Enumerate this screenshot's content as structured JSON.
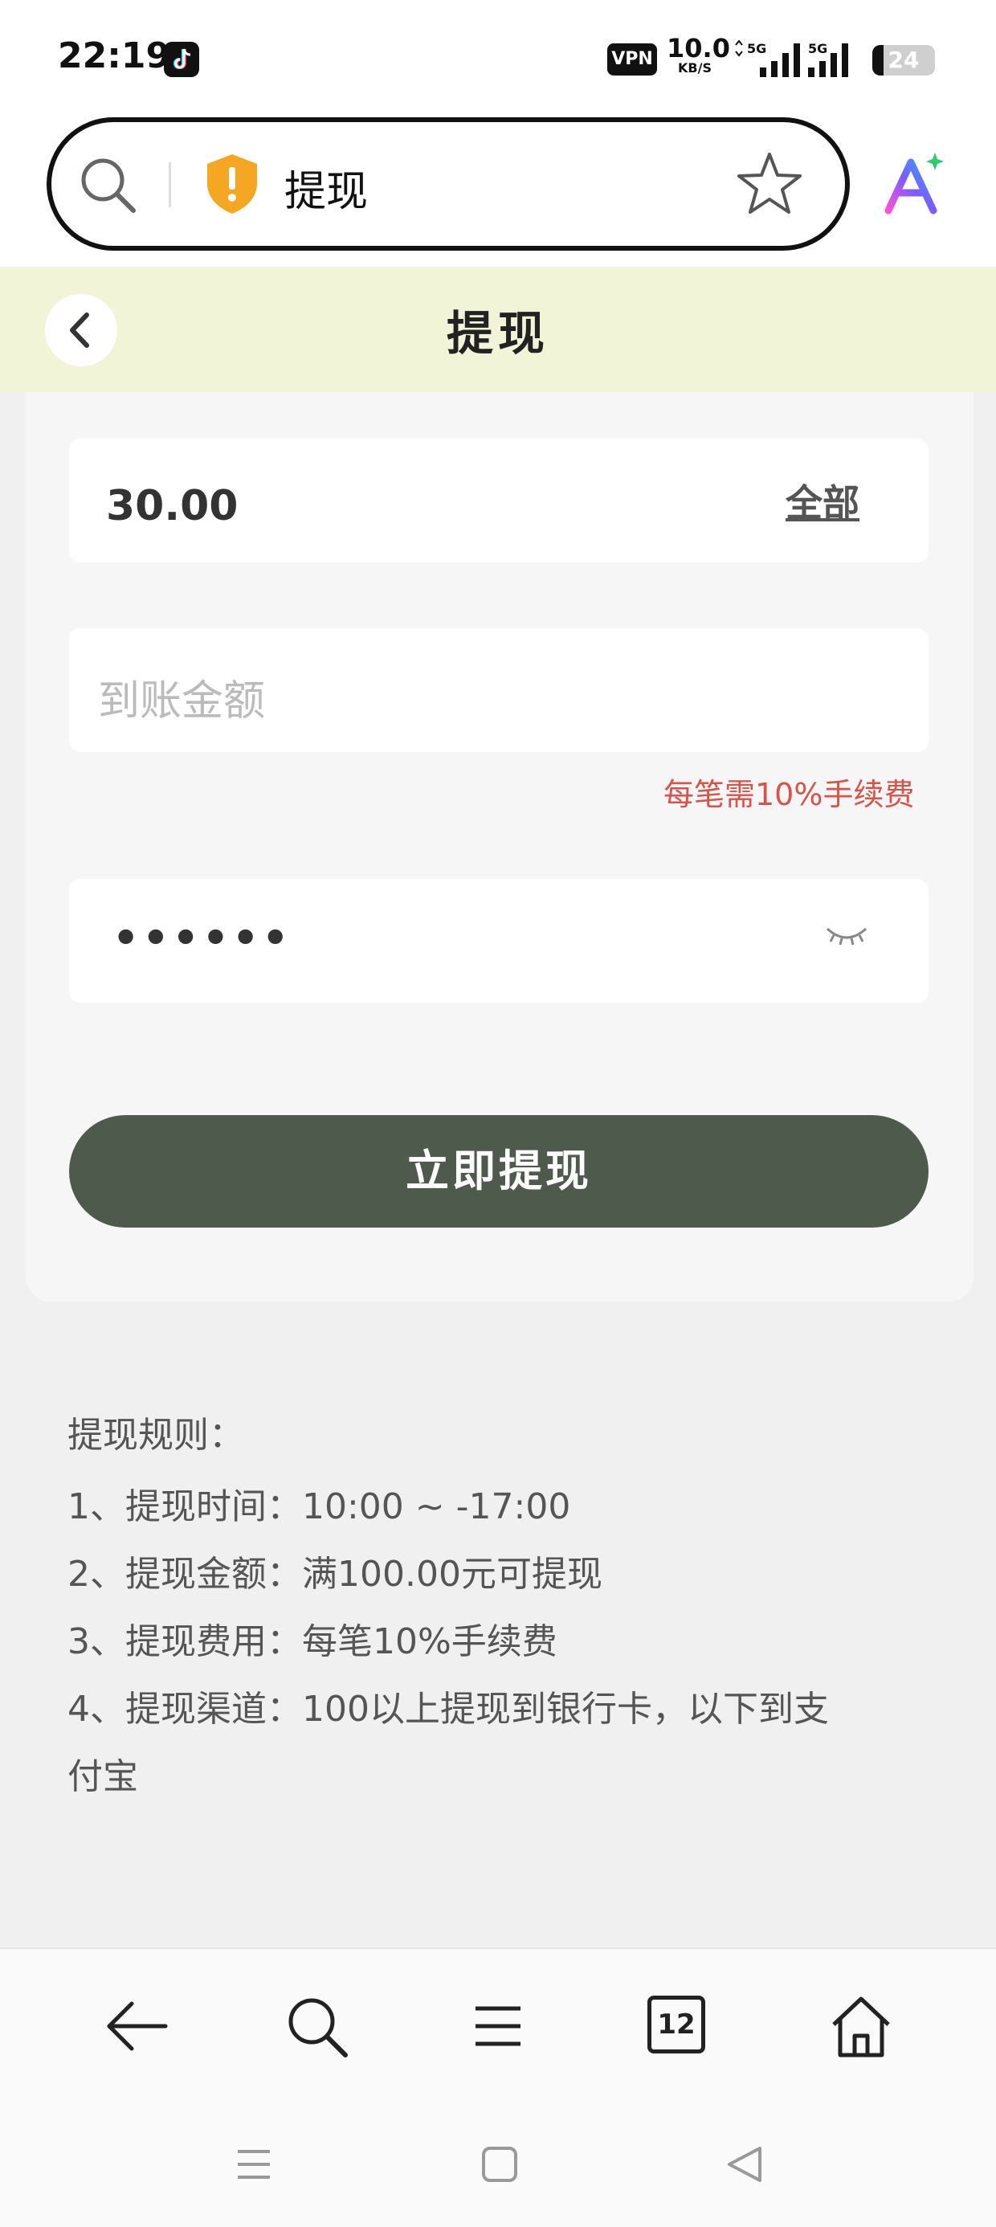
{
  "status_bar": {
    "time": "22:19",
    "vpn": "VPN",
    "net_speed_value": "10.0",
    "net_speed_unit": "KB/S",
    "signal_1_label": "5G",
    "signal_2_label": "5G",
    "battery": "24",
    "icons": [
      "tiktok-icon",
      "signal-icon",
      "battery-icon"
    ]
  },
  "browser": {
    "url_title": "提现",
    "icons": [
      "search-icon",
      "shield-warning-icon",
      "star-icon",
      "ai-assistant-icon"
    ]
  },
  "header": {
    "title": "提现"
  },
  "form": {
    "amount_value": "30.00",
    "all_label": "全部",
    "received_placeholder": "到账金额",
    "fee_note": "每笔需10%手续费",
    "password_mask": "••••••",
    "submit_label": "立即提现"
  },
  "rules": {
    "title": "提现规则：",
    "items": [
      "1、提现时间：10:00 ~ -17:00",
      "2、提现金额：满100.00元可提现",
      "3、提现费用：每笔10%手续费",
      "4、提现渠道：100以上提现到银行卡，以下到支",
      "付宝"
    ]
  },
  "bottom_nav": {
    "tab_count": "12",
    "icons": [
      "back-arrow-icon",
      "search-icon",
      "menu-icon",
      "tabs-icon",
      "home-icon"
    ]
  },
  "system_nav": {
    "icons": [
      "recent-apps-icon",
      "home-square-icon",
      "back-triangle-icon"
    ]
  }
}
